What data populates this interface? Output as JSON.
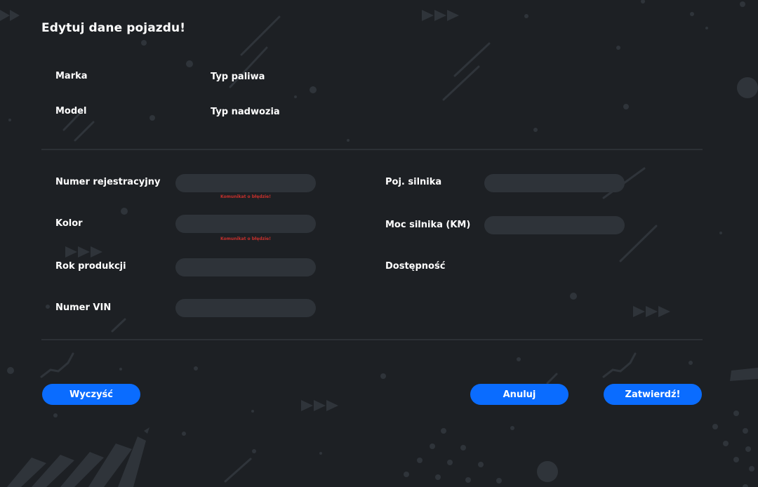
{
  "form": {
    "title": "Edytuj dane pojazdu!"
  },
  "info": {
    "marka_label": "Marka",
    "typ_paliwa_label": "Typ paliwa",
    "model_label": "Model",
    "typ_nadwozia_label": "Typ nadwozia"
  },
  "fields": {
    "numer_rejestracyjny": {
      "label": "Numer rejestracyjny",
      "value": "",
      "error": "Komunikat o błędzie!"
    },
    "kolor": {
      "label": "Kolor",
      "value": "",
      "error": "Komunikat o błędzie!"
    },
    "rok_produkcji": {
      "label": "Rok produkcji",
      "value": ""
    },
    "numer_vin": {
      "label": "Numer VIN",
      "value": ""
    },
    "poj_silnika": {
      "label": "Poj. silnika",
      "value": ""
    },
    "moc_silnika": {
      "label": "Moc silnika (KM)",
      "value": ""
    },
    "dostepnosc": {
      "label": "Dostępność"
    }
  },
  "buttons": {
    "clear": "Wyczyść",
    "cancel": "Anuluj",
    "submit": "Zatwierdź!"
  },
  "colors": {
    "background": "#1d2024",
    "field": "#2e3339",
    "divider": "#2c3035",
    "accent": "#0a6cff",
    "error": "#c9302c",
    "decoration": "#2f343a"
  }
}
